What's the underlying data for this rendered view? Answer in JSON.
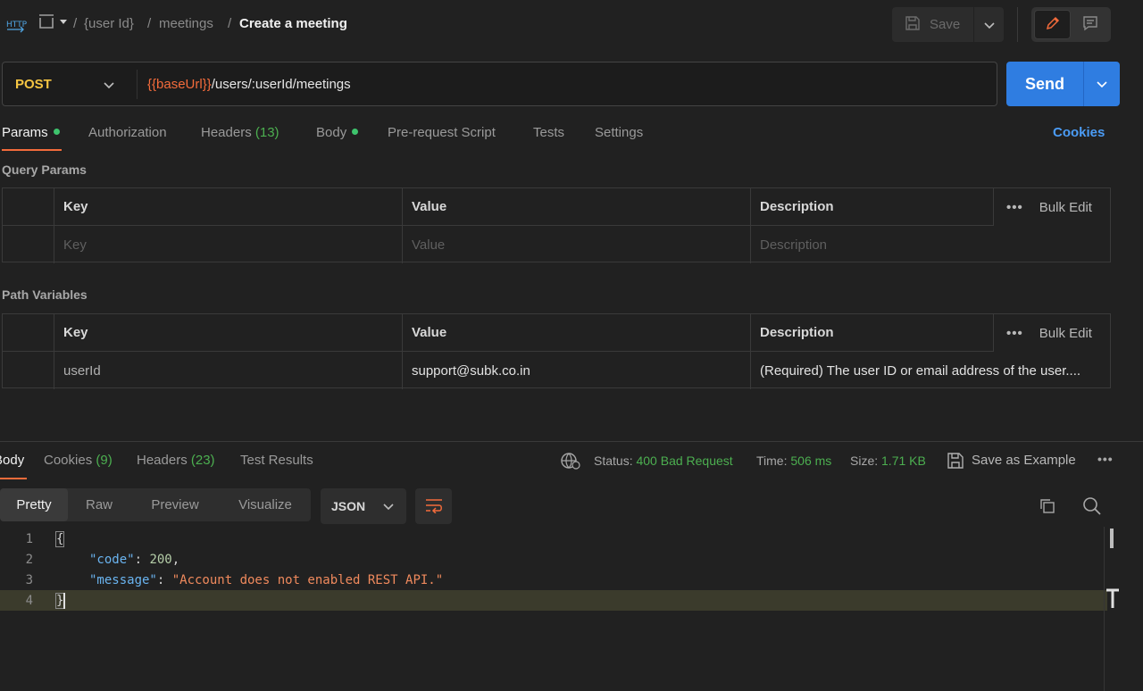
{
  "breadcrumb": {
    "items": [
      "{user Id}",
      "meetings"
    ],
    "separator": "/",
    "title": "Create a meeting"
  },
  "header": {
    "save_label": "Save"
  },
  "request": {
    "method": "POST",
    "url_var": "{{baseUrl}}",
    "url_path": "/users/:userId/meetings",
    "send_label": "Send"
  },
  "tabs": {
    "params": "Params",
    "authorization": "Authorization",
    "headers": "Headers",
    "headers_count": "(13)",
    "body": "Body",
    "prerequest": "Pre-request Script",
    "tests": "Tests",
    "settings": "Settings",
    "cookies": "Cookies"
  },
  "query_params": {
    "title": "Query Params",
    "headers": [
      "Key",
      "Value",
      "Description"
    ],
    "placeholders": [
      "Key",
      "Value",
      "Description"
    ],
    "bulk_edit": "Bulk Edit"
  },
  "path_variables": {
    "title": "Path Variables",
    "headers": [
      "Key",
      "Value",
      "Description"
    ],
    "row": [
      "userId",
      "support@subk.co.in",
      "(Required) The user ID or email address of the user...."
    ],
    "bulk_edit": "Bulk Edit"
  },
  "response": {
    "tabs": {
      "body": "Body",
      "cookies": "Cookies",
      "cookies_count": "(9)",
      "headers": "Headers",
      "headers_count": "(23)",
      "test_results": "Test Results"
    },
    "status_label": "Status:",
    "status_value": "400 Bad Request",
    "time_label": "Time:",
    "time_value": "506 ms",
    "size_label": "Size:",
    "size_value": "1.71 KB",
    "save_example": "Save as Example",
    "views": [
      "Pretty",
      "Raw",
      "Preview",
      "Visualize"
    ],
    "format": "JSON",
    "code": {
      "line_numbers": [
        "1",
        "2",
        "3",
        "4"
      ],
      "open_brace": "{",
      "close_brace": "}",
      "key1": "\"code\"",
      "colon": ": ",
      "value1": "200",
      "comma": ",",
      "key2": "\"message\"",
      "value2": "\"Account does not enabled REST API.\""
    }
  },
  "colors": {
    "accent": "#f36b3b",
    "send": "#2f7de1",
    "method": "#f5c542",
    "success": "#4caf50",
    "link": "#4b9cf5"
  }
}
